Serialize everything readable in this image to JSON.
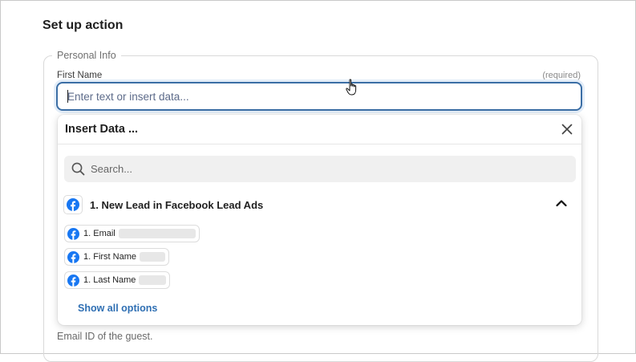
{
  "page": {
    "title": "Set up action"
  },
  "section": {
    "legend": "Personal Info",
    "field_label": "First Name",
    "required_text": "(required)",
    "input_placeholder": "Enter text or insert data...",
    "helper_text": "Email ID of the guest."
  },
  "insert_data": {
    "title": "Insert Data ...",
    "search_placeholder": "Search...",
    "group_title": "1. New Lead in Facebook Lead Ads",
    "items": [
      {
        "label": "1. Email"
      },
      {
        "label": "1. First Name"
      },
      {
        "label": "1. Last Name"
      }
    ],
    "show_all": "Show all options"
  },
  "colors": {
    "accent": "#3b6ea5",
    "facebook": "#1877f2",
    "link": "#2f6fb3"
  }
}
